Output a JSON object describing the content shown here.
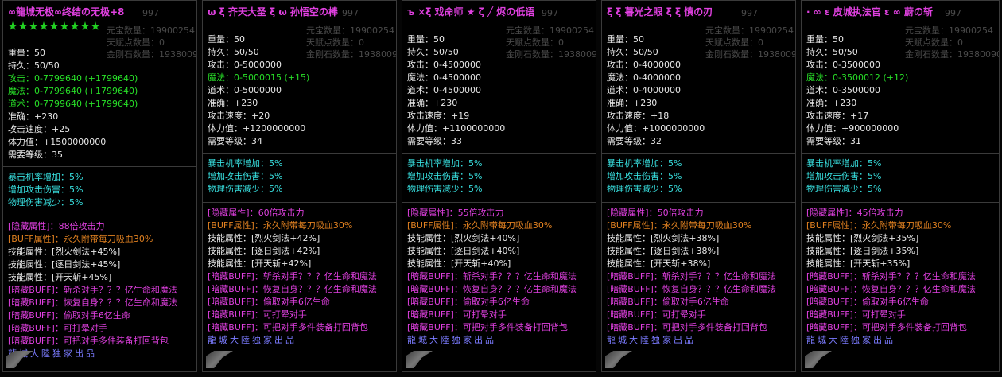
{
  "ghost": {
    "yb_label": "元宝数量：",
    "yb_value": "19900254",
    "tf_label": "天赋点数量：",
    "tf_value": "0",
    "jg_label": "金刚石数量：",
    "jg_value": "19380090",
    "top_num": "997"
  },
  "panels": [
    {
      "title": "∞龍城无极∞终结の无极+8",
      "title_color": "#e040e0",
      "star_count": 9,
      "weight": "重量：50",
      "durability": "持久：50/50",
      "attack": "攻击：0-7799640 (+1799640)",
      "attack_color": "#28e028",
      "magic": "魔法：0-7799640 (+1799640)",
      "magic_color": "#28e028",
      "tao": "道术：0-7799640 (+1799640)",
      "tao_color": "#28e028",
      "accuracy": "准确：+230",
      "speed": "攻击速度：+25",
      "hp": "体力值：+1500000000",
      "level": "需要等级：35",
      "crit": "暴击机率增加：5%",
      "dmg_up": "增加攻击伤害：5%",
      "phys_down": "物理伤害减少：5%",
      "hidden_attr": "[隐藏属性]：88倍攻击力",
      "buff_attr": "[BUFF属性]：永久附带每刀吸血30%",
      "skill1": "技能属性：[烈火剑法+45%]",
      "skill2": "技能属性：[逐日剑法+45%]",
      "skill3": "技能属性：[开天斩+45%]",
      "dark1": "[暗藏BUFF]：斩杀对手？？？亿生命和魔法",
      "dark2": "[暗藏BUFF]：恢复自身？？？亿生命和魔法",
      "dark3": "[暗藏BUFF]：偷取对手6亿生命",
      "dark4": "[暗藏BUFF]：可打晕对手",
      "dark5": "[暗藏BUFF]：可把对手多件装备打回背包",
      "footer": "龍城大陸独家出品"
    },
    {
      "title": "ω ξ 齐天大圣 ξ ω 孙悟空の棒",
      "title_color": "#e040e0",
      "star_count": 0,
      "weight": "重量：50",
      "durability": "持久：50/50",
      "attack": "攻击：0-5000000",
      "attack_color": "#e8e8e8",
      "magic": "魔法：0-5000015 (+15)",
      "magic_color": "#28e028",
      "tao": "道术：0-5000000",
      "tao_color": "#e8e8e8",
      "accuracy": "准确：+230",
      "speed": "攻击速度：+20",
      "hp": "体力值：+1200000000",
      "level": "需要等级：34",
      "crit": "暴击机率增加：5%",
      "dmg_up": "增加攻击伤害：5%",
      "phys_down": "物理伤害减少：5%",
      "hidden_attr": "[隐藏属性]：60倍攻击力",
      "buff_attr": "[BUFF属性]：永久附带每刀吸血30%",
      "skill1": "技能属性：[烈火剑法+42%]",
      "skill2": "技能属性：[逐日剑法+42%]",
      "skill3": "技能属性：[开天斩+42%]",
      "dark1": "[暗藏BUFF]：斩杀对手？？？亿生命和魔法",
      "dark2": "[暗藏BUFF]：恢复自身？？？亿生命和魔法",
      "dark3": "[暗藏BUFF]：偷取对手6亿生命",
      "dark4": "[暗藏BUFF]：可打晕对手",
      "dark5": "[暗藏BUFF]：可把对手多件装备打回背包",
      "footer": "龍城大陸独家出品"
    },
    {
      "title": "ъ ×ξ 戏命师 ★ ζ ╱ 烬の低语",
      "title_color": "#e040e0",
      "star_count": 0,
      "weight": "重量：50",
      "durability": "持久：50/50",
      "attack": "攻击：0-4500000",
      "attack_color": "#e8e8e8",
      "magic": "魔法：0-4500000",
      "magic_color": "#e8e8e8",
      "tao": "道术：0-4500000",
      "tao_color": "#e8e8e8",
      "accuracy": "准确：+230",
      "speed": "攻击速度：+19",
      "hp": "体力值：+1100000000",
      "level": "需要等级：33",
      "crit": "暴击机率增加：5%",
      "dmg_up": "增加攻击伤害：5%",
      "phys_down": "物理伤害减少：5%",
      "hidden_attr": "[隐藏属性]：55倍攻击力",
      "buff_attr": "[BUFF属性]：永久附带每刀吸血30%",
      "skill1": "技能属性：[烈火剑法+40%]",
      "skill2": "技能属性：[逐日剑法+40%]",
      "skill3": "技能属性：[开天斩+40%]",
      "dark1": "[暗藏BUFF]：斩杀对手？？？亿生命和魔法",
      "dark2": "[暗藏BUFF]：恢复自身？？？亿生命和魔法",
      "dark3": "[暗藏BUFF]：偷取对手6亿生命",
      "dark4": "[暗藏BUFF]：可打晕对手",
      "dark5": "[暗藏BUFF]：可把对手多件装备打回背包",
      "footer": "龍城大陸独家出品"
    },
    {
      "title": "ξ ξ 暮光之眼 ξ ξ 慎の刃",
      "title_color": "#e040e0",
      "star_count": 0,
      "weight": "重量：50",
      "durability": "持久：50/50",
      "attack": "攻击：0-4000000",
      "attack_color": "#e8e8e8",
      "magic": "魔法：0-4000000",
      "magic_color": "#e8e8e8",
      "tao": "道术：0-4000000",
      "tao_color": "#e8e8e8",
      "accuracy": "准确：+230",
      "speed": "攻击速度：+18",
      "hp": "体力值：+1000000000",
      "level": "需要等级：32",
      "crit": "暴击机率增加：5%",
      "dmg_up": "增加攻击伤害：5%",
      "phys_down": "物理伤害减少：5%",
      "hidden_attr": "[隐藏属性]：50倍攻击力",
      "buff_attr": "[BUFF属性]：永久附带每刀吸血30%",
      "skill1": "技能属性：[烈火剑法+38%]",
      "skill2": "技能属性：[逐日剑法+38%]",
      "skill3": "技能属性：[开天斩+38%]",
      "dark1": "[暗藏BUFF]：斩杀对手？？？亿生命和魔法",
      "dark2": "[暗藏BUFF]：恢复自身？？？亿生命和魔法",
      "dark3": "[暗藏BUFF]：偷取对手6亿生命",
      "dark4": "[暗藏BUFF]：可打晕对手",
      "dark5": "[暗藏BUFF]：可把对手多件装备打回背包",
      "footer": "龍城大陸独家出品"
    },
    {
      "title": "· ∞ ε 皮城执法官 ε ∞ 蔚の斩",
      "title_color": "#e040e0",
      "star_count": 0,
      "weight": "重量：50",
      "durability": "持久：50/50",
      "attack": "攻击：0-3500000",
      "attack_color": "#e8e8e8",
      "magic": "魔法：0-3500012 (+12)",
      "magic_color": "#28e028",
      "tao": "道术：0-3500000",
      "tao_color": "#e8e8e8",
      "accuracy": "准确：+230",
      "speed": "攻击速度：+17",
      "hp": "体力值：+900000000",
      "level": "需要等级：31",
      "crit": "暴击机率增加：5%",
      "dmg_up": "增加攻击伤害：5%",
      "phys_down": "物理伤害减少：5%",
      "hidden_attr": "[隐藏属性]：45倍攻击力",
      "buff_attr": "[BUFF属性]：永久附带每刀吸血30%",
      "skill1": "技能属性：[烈火剑法+35%]",
      "skill2": "技能属性：[逐日剑法+35%]",
      "skill3": "技能属性：[开天斩+35%]",
      "dark1": "[暗藏BUFF]：斩杀对手？？？亿生命和魔法",
      "dark2": "[暗藏BUFF]：恢复自身？？？亿生命和魔法",
      "dark3": "[暗藏BUFF]：偷取对手6亿生命",
      "dark4": "[暗藏BUFF]：可打晕对手",
      "dark5": "[暗藏BUFF]：可把对手多件装备打回背包",
      "footer": "龍城大陸独家出品"
    }
  ]
}
